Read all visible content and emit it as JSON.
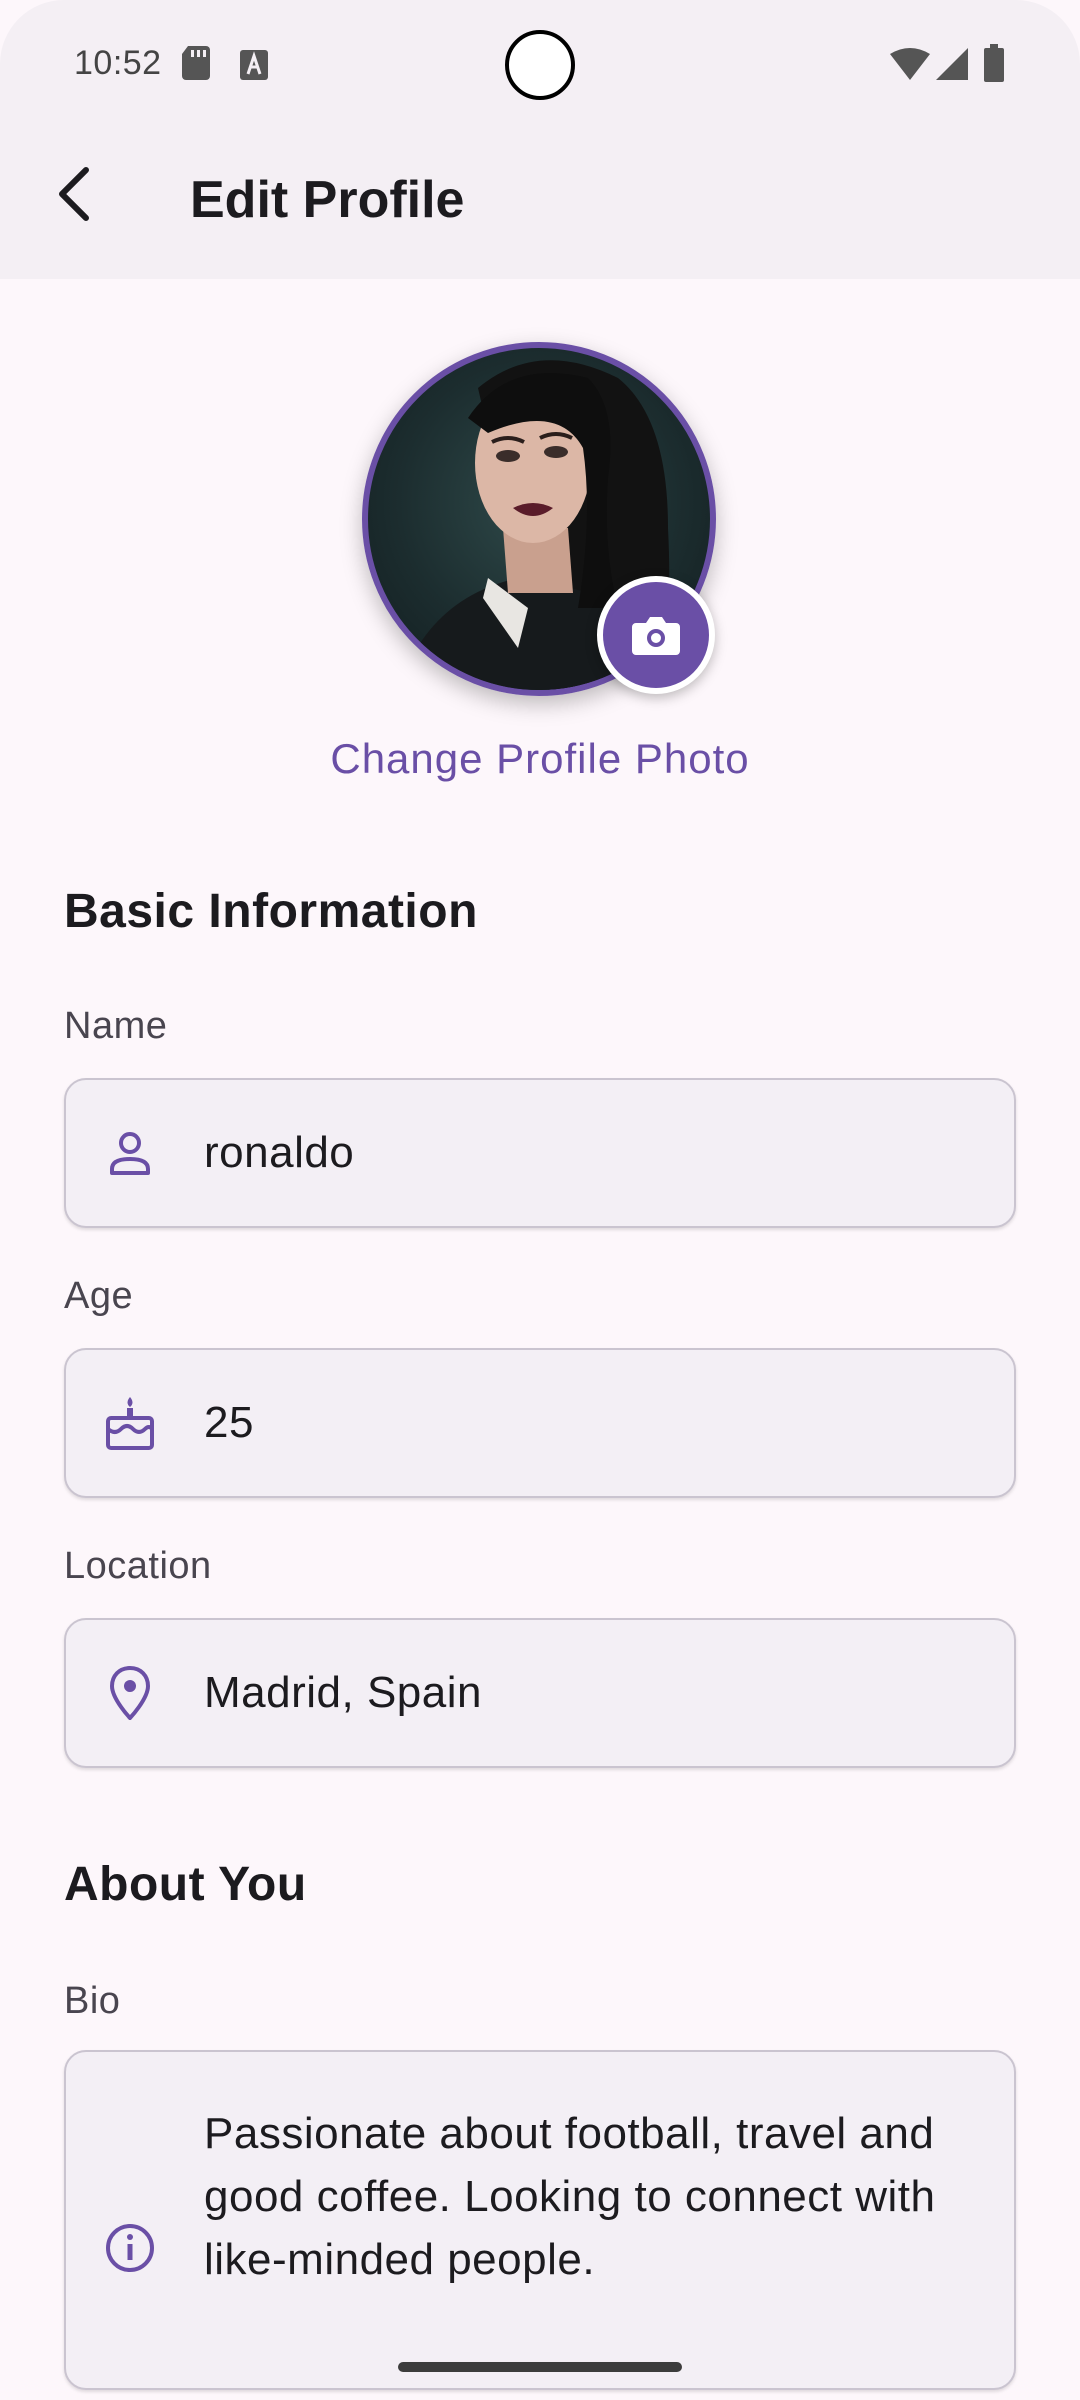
{
  "status_bar": {
    "time": "10:52",
    "icons_left": [
      "sd-card-icon",
      "keyboard-a-icon"
    ],
    "icons_right": [
      "wifi-icon",
      "signal-icon",
      "battery-icon"
    ]
  },
  "app_bar": {
    "title": "Edit Profile",
    "back_icon": "chevron-left-icon"
  },
  "profile_photo": {
    "change_label": "Change Profile Photo",
    "badge_icon": "camera-icon"
  },
  "basic_info": {
    "section_title": "Basic Information",
    "name": {
      "label": "Name",
      "value": "ronaldo",
      "icon": "person-icon"
    },
    "age": {
      "label": "Age",
      "value": "25",
      "icon": "cake-icon"
    },
    "location": {
      "label": "Location",
      "value": "Madrid, Spain",
      "icon": "location-pin-icon"
    }
  },
  "about_you": {
    "section_title": "About You",
    "bio": {
      "label": "Bio",
      "value": "Passionate about football, travel and good coffee. Looking to connect with like-minded people.",
      "icon": "info-icon"
    }
  },
  "colors": {
    "accent": "#6a4fa6",
    "app_bar_bg": "#f4eff4",
    "page_bg": "#fdf7fb",
    "field_bg": "#f3eff5",
    "text_primary": "#1c1b1f",
    "text_label": "#49454f"
  }
}
